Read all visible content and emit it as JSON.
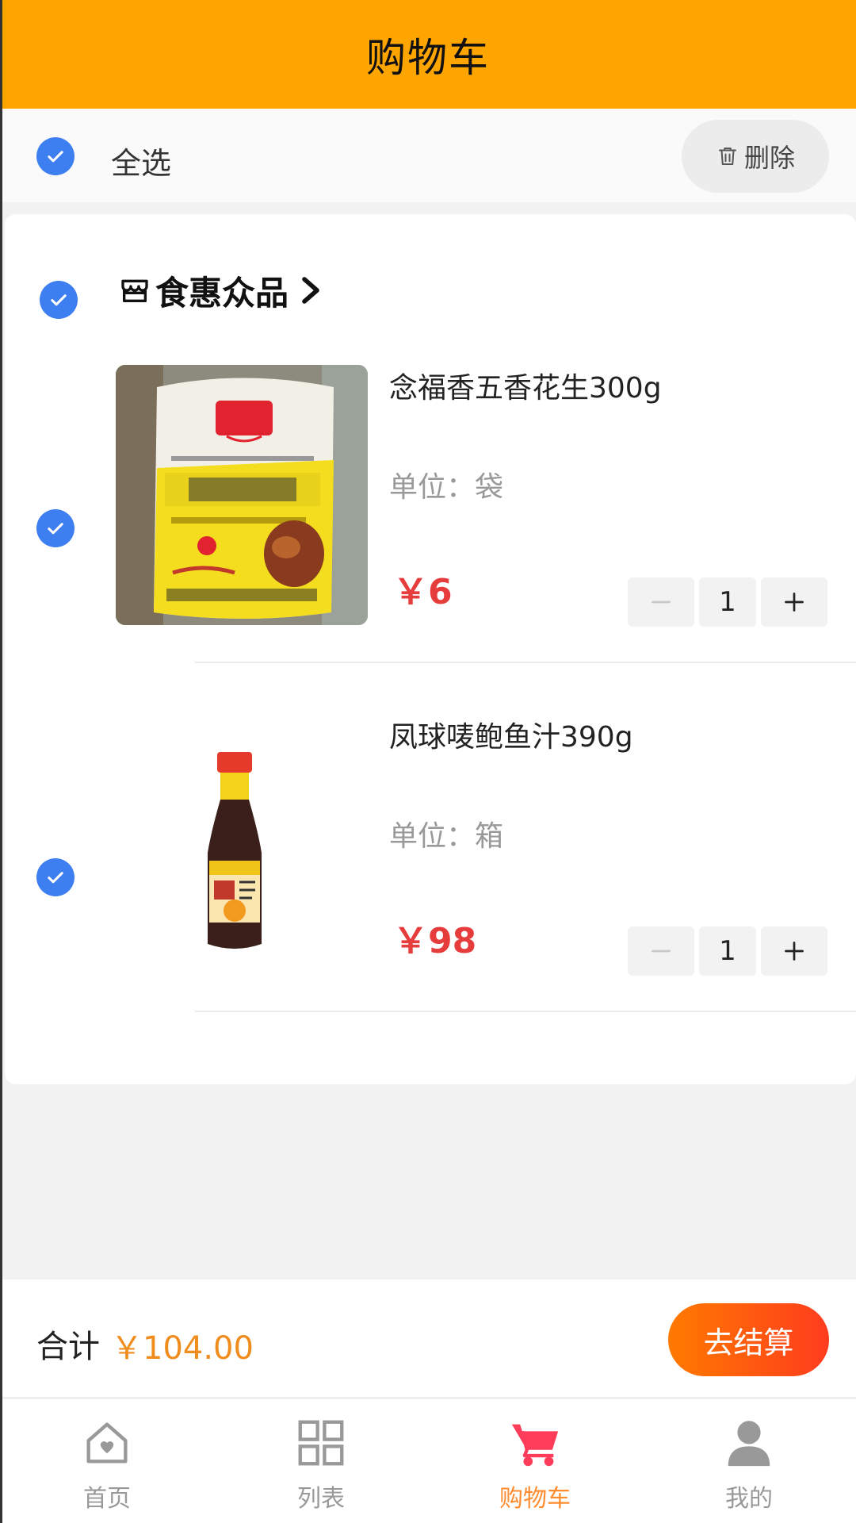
{
  "header": {
    "title": "购物车"
  },
  "toolbar": {
    "select_all_label": "全选",
    "delete_label": "删除"
  },
  "store": {
    "name": "食惠众品"
  },
  "items": [
    {
      "name": "念福香五香花生300g",
      "unit": "单位：袋",
      "price": "￥6",
      "quantity": "1"
    },
    {
      "name": "凤球唛鲍鱼汁390g",
      "unit": "单位：箱",
      "price": "￥98",
      "quantity": "1"
    }
  ],
  "footer": {
    "total_label": "合计",
    "total_value": "￥104.00",
    "checkout_label": "去结算"
  },
  "tabs": [
    {
      "label": "首页",
      "icon": "home-icon"
    },
    {
      "label": "列表",
      "icon": "grid-icon"
    },
    {
      "label": "购物车",
      "icon": "cart-icon",
      "active": true
    },
    {
      "label": "我的",
      "icon": "user-icon"
    }
  ],
  "colors": {
    "header": "#ffa500",
    "check": "#3d7ef0",
    "price": "#e63c3c",
    "total": "#f08c1e",
    "active_tab": "#ff3c5a"
  }
}
